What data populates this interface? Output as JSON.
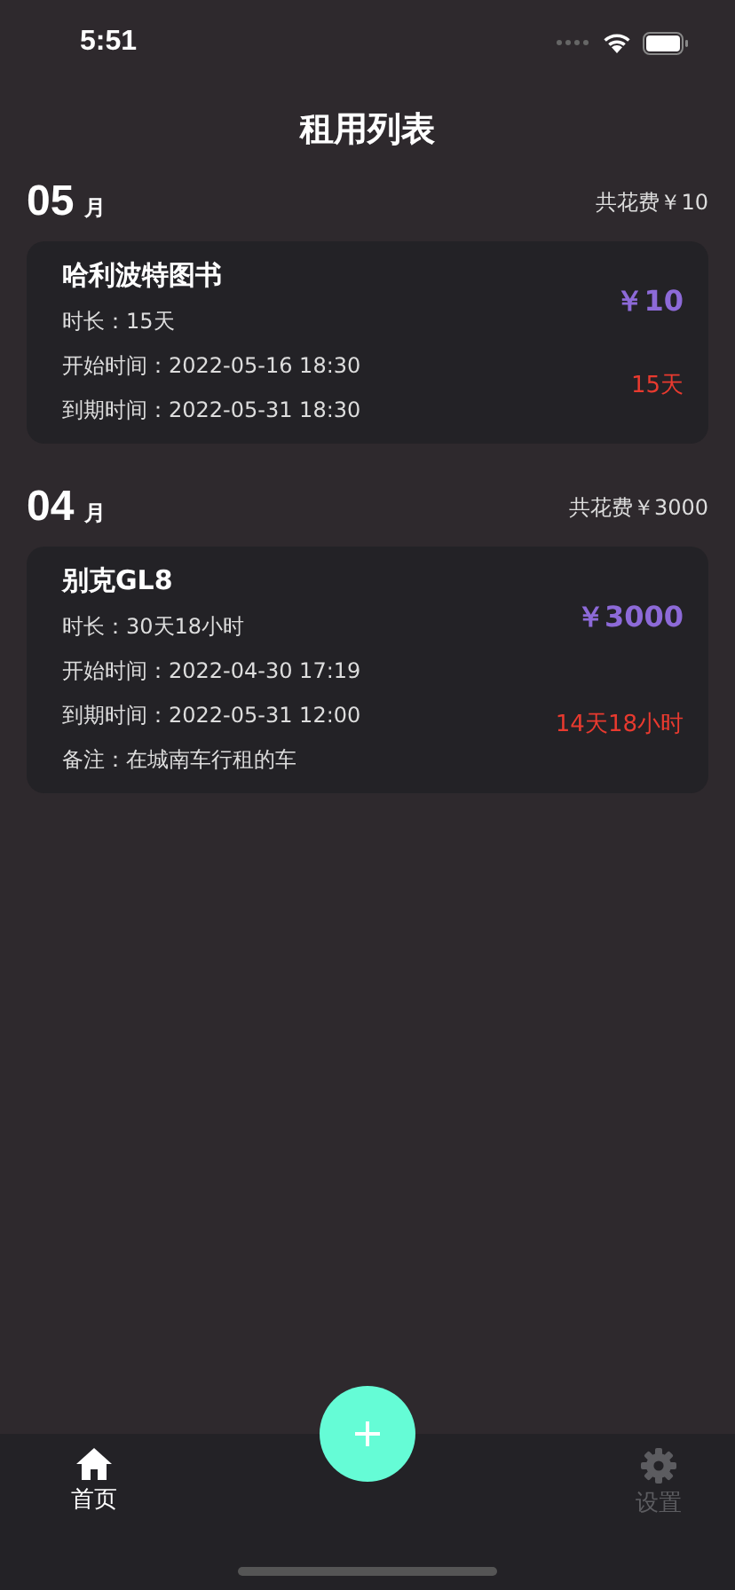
{
  "status_bar": {
    "time": "5:51"
  },
  "title": "租用列表",
  "months": [
    {
      "month": "05",
      "unit": "月",
      "total": "共花费￥10",
      "rentals": [
        {
          "name": "哈利波特图书",
          "price": "￥10",
          "remaining": "15天",
          "lines": [
            "时长：15天",
            "开始时间：2022-05-16 18:30",
            "到期时间：2022-05-31 18:30"
          ]
        }
      ]
    },
    {
      "month": "04",
      "unit": "月",
      "total": "共花费￥3000",
      "rentals": [
        {
          "name": "别克GL8",
          "price": "￥3000",
          "remaining": "14天18小时",
          "lines": [
            "时长：30天18小时",
            "开始时间：2022-04-30 17:19",
            "到期时间：2022-05-31 12:00",
            "备注：在城南车行租的车"
          ]
        }
      ]
    }
  ],
  "tab_bar": [
    {
      "label": "首页",
      "kind": "home",
      "selected": true
    },
    {
      "label": "设置",
      "kind": "settings",
      "selected": false
    }
  ]
}
